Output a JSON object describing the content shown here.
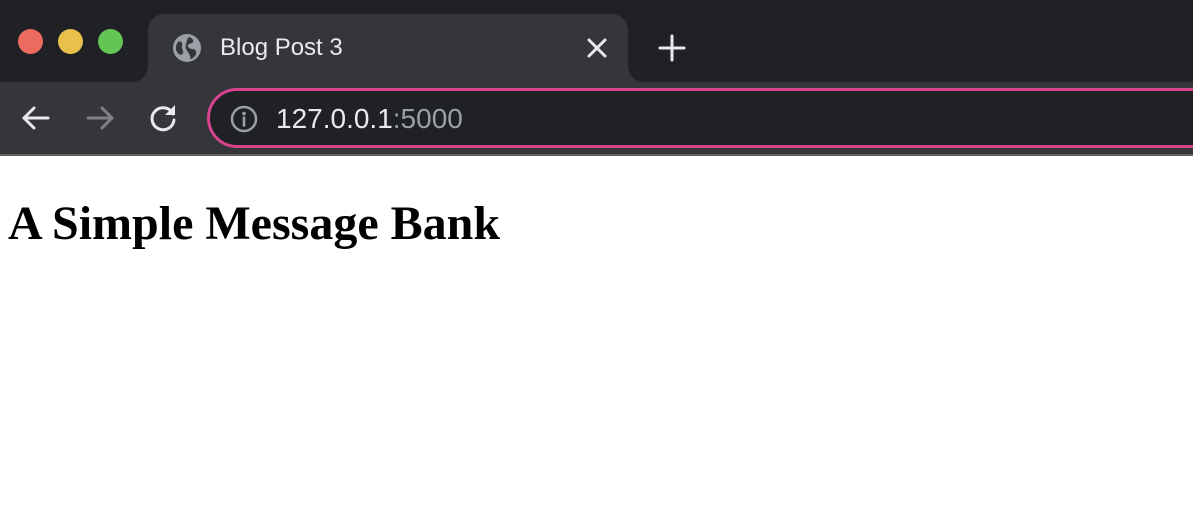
{
  "window": {
    "traffic_lights": {
      "close_color": "#ed6a5e",
      "minimize_color": "#e8c04b",
      "maximize_color": "#62c554"
    }
  },
  "tabs": [
    {
      "title": "Blog Post 3",
      "favicon": "globe-icon",
      "close_icon": "close-icon",
      "active": true
    }
  ],
  "new_tab_icon": "plus-icon",
  "toolbar": {
    "back_icon": "arrow-left-icon",
    "forward_icon": "arrow-right-icon",
    "reload_icon": "reload-icon",
    "forward_enabled": false
  },
  "omnibox": {
    "security_icon": "info-icon",
    "url_host": "127.0.0.1",
    "url_port": ":5000",
    "focus_ring_color": "#d6438f"
  },
  "page": {
    "heading": "A Simple Message Bank"
  },
  "colors": {
    "tabstrip_bg": "#202124",
    "toolbar_bg": "#35363a",
    "page_bg": "#ffffff"
  }
}
